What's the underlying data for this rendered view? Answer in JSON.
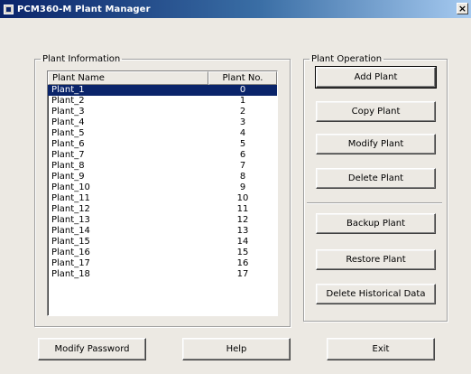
{
  "window": {
    "title": "PCM360-M Plant Manager",
    "close_symbol": "×"
  },
  "plant_information": {
    "legend": "Plant Information",
    "columns": [
      "Plant Name",
      "Plant No."
    ],
    "selected_index": 0,
    "rows": [
      {
        "name": "Plant_1",
        "no": "0"
      },
      {
        "name": "Plant_2",
        "no": "1"
      },
      {
        "name": "Plant_3",
        "no": "2"
      },
      {
        "name": "Plant_4",
        "no": "3"
      },
      {
        "name": "Plant_5",
        "no": "4"
      },
      {
        "name": "Plant_6",
        "no": "5"
      },
      {
        "name": "Plant_7",
        "no": "6"
      },
      {
        "name": "Plant_8",
        "no": "7"
      },
      {
        "name": "Plant_9",
        "no": "8"
      },
      {
        "name": "Plant_10",
        "no": "9"
      },
      {
        "name": "Plant_11",
        "no": "10"
      },
      {
        "name": "Plant_12",
        "no": "11"
      },
      {
        "name": "Plant_13",
        "no": "12"
      },
      {
        "name": "Plant_14",
        "no": "13"
      },
      {
        "name": "Plant_15",
        "no": "14"
      },
      {
        "name": "Plant_16",
        "no": "15"
      },
      {
        "name": "Plant_17",
        "no": "16"
      },
      {
        "name": "Plant_18",
        "no": "17"
      }
    ]
  },
  "plant_operation": {
    "legend": "Plant Operation",
    "add_label": "Add Plant",
    "copy_label": "Copy Plant",
    "modify_label": "Modify Plant",
    "delete_label": "Delete Plant",
    "backup_label": "Backup Plant",
    "restore_label": "Restore Plant",
    "delete_history_label": "Delete Historical Data"
  },
  "footer": {
    "modify_password_label": "Modify Password",
    "help_label": "Help",
    "exit_label": "Exit"
  },
  "colors": {
    "title_gradient_start": "#0a246a",
    "selection": "#0a246a",
    "face": "#ece9e3"
  },
  "icons": {
    "app": "app-window-icon",
    "close": "close-icon"
  }
}
